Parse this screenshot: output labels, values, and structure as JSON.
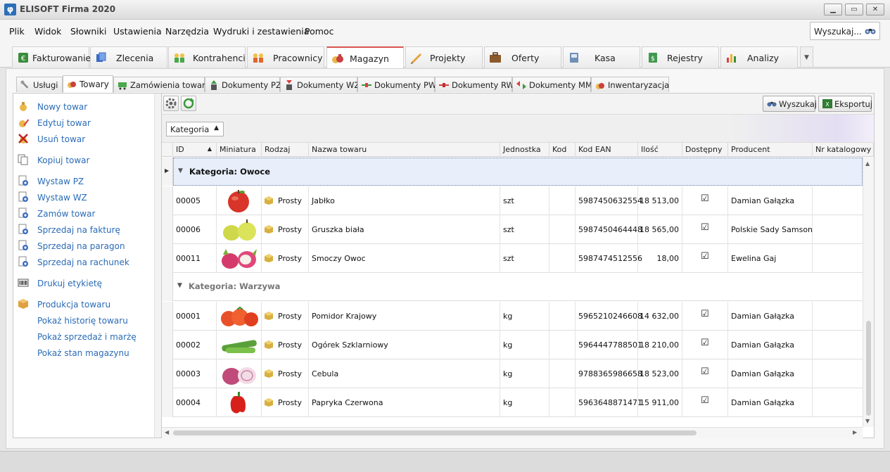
{
  "window": {
    "title": "ELISOFT Firma 2020",
    "icon_glyph": "φ"
  },
  "menu": [
    "Plik",
    "Widok",
    "Słowniki",
    "Ustawienia",
    "Narzędzia",
    "Wydruki i zestawienia",
    "Pomoc"
  ],
  "search": {
    "placeholder": "Wyszukaj..."
  },
  "main_tabs": [
    {
      "label": "Fakturowanie",
      "icon": "currency-icon"
    },
    {
      "label": "Zlecenia",
      "icon": "documents-icon"
    },
    {
      "label": "Kontrahenci",
      "icon": "people-icon"
    },
    {
      "label": "Pracownicy",
      "icon": "workers-icon"
    },
    {
      "label": "Magazyn",
      "icon": "money-bags-icon",
      "active": true
    },
    {
      "label": "Projekty",
      "icon": "pencil-ruler-icon"
    },
    {
      "label": "Oferty",
      "icon": "briefcase-icon"
    },
    {
      "label": "Kasa",
      "icon": "cash-register-icon"
    },
    {
      "label": "Rejestry",
      "icon": "register-book-icon"
    },
    {
      "label": "Analizy",
      "icon": "bar-chart-icon"
    }
  ],
  "sub_tabs": [
    {
      "label": "Usługi",
      "icon": "wrench-icon"
    },
    {
      "label": "Towary",
      "icon": "money-bags-icon",
      "active": true
    },
    {
      "label": "Zamówienia towaru",
      "icon": "cart-icon"
    },
    {
      "label": "Dokumenty PZ",
      "icon": "document-in-icon"
    },
    {
      "label": "Dokumenty WZ",
      "icon": "document-out-icon"
    },
    {
      "label": "Dokumenty PW",
      "icon": "arrows-in-icon"
    },
    {
      "label": "Dokumenty RW",
      "icon": "arrows-out-icon"
    },
    {
      "label": "Dokumenty MM",
      "icon": "transfer-icon"
    },
    {
      "label": "Inwentaryzacja",
      "icon": "inventory-icon"
    }
  ],
  "left_actions": [
    {
      "label": "Nowy towar",
      "icon": "new-item-icon"
    },
    {
      "label": "Edytuj towar",
      "icon": "edit-item-icon"
    },
    {
      "label": "Usuń towar",
      "icon": "delete-item-icon"
    },
    {
      "label": "Kopiuj towar",
      "icon": "copy-icon"
    },
    {
      "label": "Wystaw PZ",
      "icon": "document-add-icon"
    },
    {
      "label": "Wystaw WZ",
      "icon": "document-add-icon"
    },
    {
      "label": "Zamów towar",
      "icon": "document-add-icon"
    },
    {
      "label": "Sprzedaj na fakturę",
      "icon": "document-add-icon"
    },
    {
      "label": "Sprzedaj na paragon",
      "icon": "document-add-icon"
    },
    {
      "label": "Sprzedaj na rachunek",
      "icon": "document-add-icon"
    },
    {
      "label": "Drukuj etykietę",
      "icon": "barcode-icon"
    },
    {
      "label": "Produkcja towaru",
      "icon": "box-icon"
    },
    {
      "label": "Pokaż historię towaru",
      "icon": ""
    },
    {
      "label": "Pokaż sprzedaż i marżę",
      "icon": ""
    },
    {
      "label": "Pokaż stan magazynu",
      "icon": ""
    }
  ],
  "toolbar": {
    "search_label": "Wyszukaj",
    "export_label": "Eksportuj"
  },
  "group_by": {
    "label": "Kategoria"
  },
  "columns": [
    "ID",
    "Miniatura",
    "Rodzaj",
    "Nazwa towaru",
    "Jednostka",
    "Kod",
    "Kod EAN",
    "Ilość",
    "Dostępny",
    "Producent",
    "Nr katalogowy"
  ],
  "groups": [
    {
      "label": "Kategoria: Owoce",
      "rows": [
        {
          "id": "00005",
          "thumb": "apple",
          "type": "Prosty",
          "name": "Jabłko",
          "unit": "szt",
          "code": "",
          "ean": "5987450632554",
          "qty": "18 513,00",
          "available": true,
          "producer": "Damian Gałązka",
          "catalog": ""
        },
        {
          "id": "00006",
          "thumb": "pear",
          "type": "Prosty",
          "name": "Gruszka biała",
          "unit": "szt",
          "code": "",
          "ean": "5987450464448",
          "qty": "18 565,00",
          "available": true,
          "producer": "Polskie Sady Samson",
          "catalog": ""
        },
        {
          "id": "00011",
          "thumb": "dragonfruit",
          "type": "Prosty",
          "name": "Smoczy Owoc",
          "unit": "szt",
          "code": "",
          "ean": "5987474512556",
          "qty": "18,00",
          "available": true,
          "producer": "Ewelina Gaj",
          "catalog": ""
        }
      ]
    },
    {
      "label": "Kategoria: Warzywa",
      "rows": [
        {
          "id": "00001",
          "thumb": "tomato",
          "type": "Prosty",
          "name": "Pomidor Krajowy",
          "unit": "kg",
          "code": "",
          "ean": "5965210246608",
          "qty": "14 632,00",
          "available": true,
          "producer": "Damian Gałązka",
          "catalog": ""
        },
        {
          "id": "00002",
          "thumb": "cucumber",
          "type": "Prosty",
          "name": "Ogórek Szklarniowy",
          "unit": "kg",
          "code": "",
          "ean": "5964447788501",
          "qty": "18 210,00",
          "available": true,
          "producer": "Damian Gałązka",
          "catalog": ""
        },
        {
          "id": "00003",
          "thumb": "onion",
          "type": "Prosty",
          "name": "Cebula",
          "unit": "kg",
          "code": "",
          "ean": "9788365986658",
          "qty": "18 523,00",
          "available": true,
          "producer": "Damian Gałązka",
          "catalog": ""
        },
        {
          "id": "00004",
          "thumb": "pepper",
          "type": "Prosty",
          "name": "Papryka Czerwona",
          "unit": "kg",
          "code": "",
          "ean": "5963648871471",
          "qty": "15 911,00",
          "available": true,
          "producer": "Damian Gałązka",
          "catalog": ""
        }
      ]
    }
  ],
  "colors": {
    "link": "#2a6bb6",
    "active_tab_accent": "#d9534f",
    "selection": "#e8effb"
  }
}
